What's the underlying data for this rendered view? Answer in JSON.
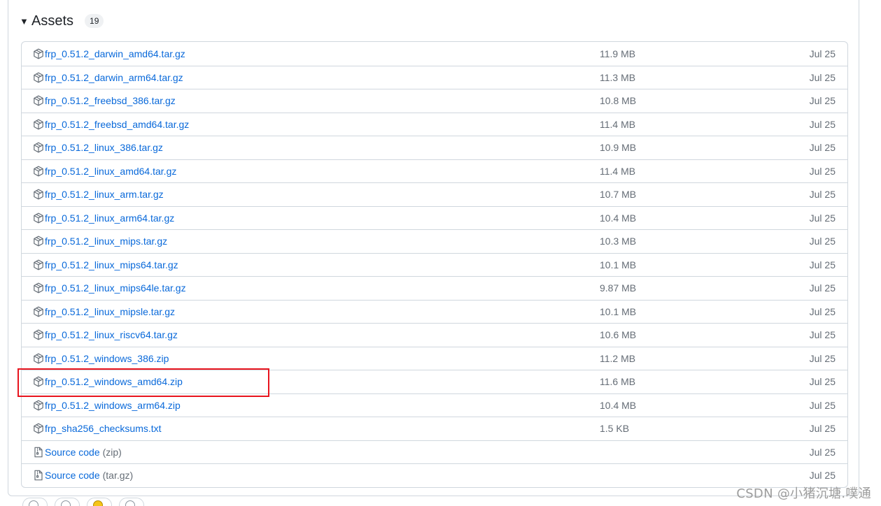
{
  "assets": {
    "caret": "▼",
    "title": "Assets",
    "count": "19",
    "items": [
      {
        "name": "frp_0.51.2_darwin_amd64.tar.gz",
        "ext": "",
        "size": "11.9 MB",
        "date": "Jul 25",
        "icon": "package-icon"
      },
      {
        "name": "frp_0.51.2_darwin_arm64.tar.gz",
        "ext": "",
        "size": "11.3 MB",
        "date": "Jul 25",
        "icon": "package-icon"
      },
      {
        "name": "frp_0.51.2_freebsd_386.tar.gz",
        "ext": "",
        "size": "10.8 MB",
        "date": "Jul 25",
        "icon": "package-icon"
      },
      {
        "name": "frp_0.51.2_freebsd_amd64.tar.gz",
        "ext": "",
        "size": "11.4 MB",
        "date": "Jul 25",
        "icon": "package-icon"
      },
      {
        "name": "frp_0.51.2_linux_386.tar.gz",
        "ext": "",
        "size": "10.9 MB",
        "date": "Jul 25",
        "icon": "package-icon"
      },
      {
        "name": "frp_0.51.2_linux_amd64.tar.gz",
        "ext": "",
        "size": "11.4 MB",
        "date": "Jul 25",
        "icon": "package-icon"
      },
      {
        "name": "frp_0.51.2_linux_arm.tar.gz",
        "ext": "",
        "size": "10.7 MB",
        "date": "Jul 25",
        "icon": "package-icon"
      },
      {
        "name": "frp_0.51.2_linux_arm64.tar.gz",
        "ext": "",
        "size": "10.4 MB",
        "date": "Jul 25",
        "icon": "package-icon"
      },
      {
        "name": "frp_0.51.2_linux_mips.tar.gz",
        "ext": "",
        "size": "10.3 MB",
        "date": "Jul 25",
        "icon": "package-icon"
      },
      {
        "name": "frp_0.51.2_linux_mips64.tar.gz",
        "ext": "",
        "size": "10.1 MB",
        "date": "Jul 25",
        "icon": "package-icon"
      },
      {
        "name": "frp_0.51.2_linux_mips64le.tar.gz",
        "ext": "",
        "size": "9.87 MB",
        "date": "Jul 25",
        "icon": "package-icon"
      },
      {
        "name": "frp_0.51.2_linux_mipsle.tar.gz",
        "ext": "",
        "size": "10.1 MB",
        "date": "Jul 25",
        "icon": "package-icon"
      },
      {
        "name": "frp_0.51.2_linux_riscv64.tar.gz",
        "ext": "",
        "size": "10.6 MB",
        "date": "Jul 25",
        "icon": "package-icon"
      },
      {
        "name": "frp_0.51.2_windows_386.zip",
        "ext": "",
        "size": "11.2 MB",
        "date": "Jul 25",
        "icon": "package-icon"
      },
      {
        "name": "frp_0.51.2_windows_amd64.zip",
        "ext": "",
        "size": "11.6 MB",
        "date": "Jul 25",
        "icon": "package-icon",
        "highlighted": true
      },
      {
        "name": "frp_0.51.2_windows_arm64.zip",
        "ext": "",
        "size": "10.4 MB",
        "date": "Jul 25",
        "icon": "package-icon"
      },
      {
        "name": "frp_sha256_checksums.txt",
        "ext": "",
        "size": "1.5 KB",
        "date": "Jul 25",
        "icon": "package-icon"
      },
      {
        "name": "Source code",
        "ext": "(zip)",
        "size": "",
        "date": "Jul 25",
        "icon": "file-zip-icon"
      },
      {
        "name": "Source code",
        "ext": "(tar.gz)",
        "size": "",
        "date": "Jul 25",
        "icon": "file-zip-icon"
      }
    ]
  },
  "colors": {
    "link": "#0969da",
    "muted": "#656d76",
    "border": "#d0d7de",
    "highlight": "#e8141e"
  },
  "watermark": "CSDN @小猪沉塘.噗通"
}
